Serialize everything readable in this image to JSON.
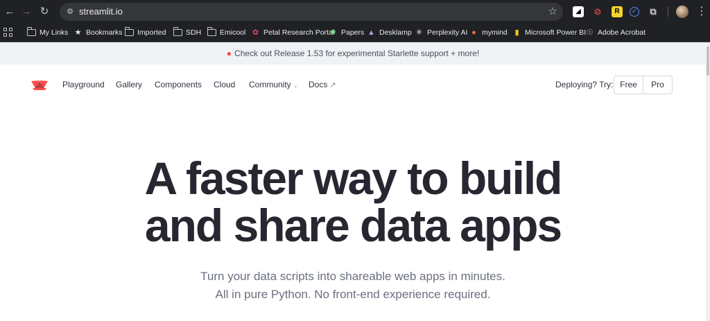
{
  "browser": {
    "url": "streamlit.io",
    "bookmarks": [
      {
        "label": "My Links",
        "icon": "folder-icon"
      },
      {
        "label": "Bookmarks",
        "icon": "star-icon"
      },
      {
        "label": "Imported",
        "icon": "folder-icon"
      },
      {
        "label": "SDH",
        "icon": "folder-icon"
      },
      {
        "label": "Emicool",
        "icon": "folder-icon"
      },
      {
        "label": "Petal Research Portal",
        "icon": "petal-icon"
      },
      {
        "label": "Papers",
        "icon": "papers-icon"
      },
      {
        "label": "Desklamp",
        "icon": "desklamp-icon"
      },
      {
        "label": "Perplexity AI",
        "icon": "perplexity-icon"
      },
      {
        "label": "mymind",
        "icon": "mymind-icon"
      },
      {
        "label": "Microsoft Power BI",
        "icon": "powerbi-icon"
      },
      {
        "label": "Adobe Acrobat",
        "icon": "globe-icon"
      }
    ],
    "extensions": [
      {
        "name": "notion-extension-icon",
        "glyph": "◢"
      },
      {
        "name": "clip-extension-icon",
        "glyph": "⊘"
      },
      {
        "name": "readwise-extension-icon",
        "glyph": "R"
      },
      {
        "name": "check-extension-icon",
        "glyph": "✓"
      },
      {
        "name": "puzzle-extension-icon",
        "glyph": "⧉"
      }
    ]
  },
  "banner": {
    "text": "Check out Release 1.53 for experimental Starlette support + more!"
  },
  "nav": {
    "items": [
      {
        "label": "Playground"
      },
      {
        "label": "Gallery"
      },
      {
        "label": "Components"
      },
      {
        "label": "Cloud"
      },
      {
        "label": "Community"
      },
      {
        "label": "Docs"
      }
    ],
    "deploy_label": "Deploying? Try:",
    "free_label": "Free",
    "pro_label": "Pro"
  },
  "hero": {
    "title_line1": "A faster way to build",
    "title_line2": "and share data apps",
    "subtitle_line1": "Turn your data scripts into shareable web apps in minutes.",
    "subtitle_line2": "All in pure Python. No front-end experience required."
  },
  "colors": {
    "brand_red": "#ff4b4b",
    "chrome_bg": "#202124",
    "banner_bg": "#f0f2f6",
    "title": "#262730"
  }
}
